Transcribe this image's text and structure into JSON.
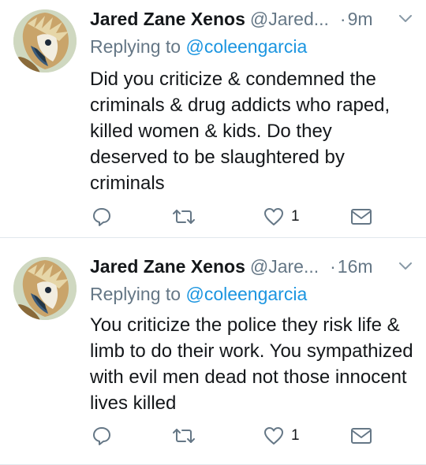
{
  "tweets": [
    {
      "author_name": "Jared Zane Xenos",
      "handle": "@Jared...",
      "dot": "·",
      "time": "9m",
      "reply_prefix": "Replying to",
      "reply_to": "@coleengarcia",
      "text": "Did you criticize & condemned the criminals & drug addicts who raped, killed women & kids. Do they deserved to be slaughtered by criminals",
      "like_count": "1"
    },
    {
      "author_name": "Jared Zane Xenos",
      "handle": "@Jare...",
      "dot": "·",
      "time": "16m",
      "reply_prefix": "Replying to",
      "reply_to": "@coleengarcia",
      "text": "You criticize the police they risk life & limb to do their work. You sympathized with evil men dead not those innocent lives killed",
      "like_count": "1"
    }
  ],
  "icons": {
    "avatar": "eagle-avatar",
    "menu": "chevron-down-icon",
    "reply": "reply-icon",
    "retweet": "retweet-icon",
    "like": "heart-icon",
    "message": "envelope-icon"
  },
  "colors": {
    "text": "#14171a",
    "secondary": "#657786",
    "link": "#1b95e0",
    "divider": "#e1e8ed"
  }
}
